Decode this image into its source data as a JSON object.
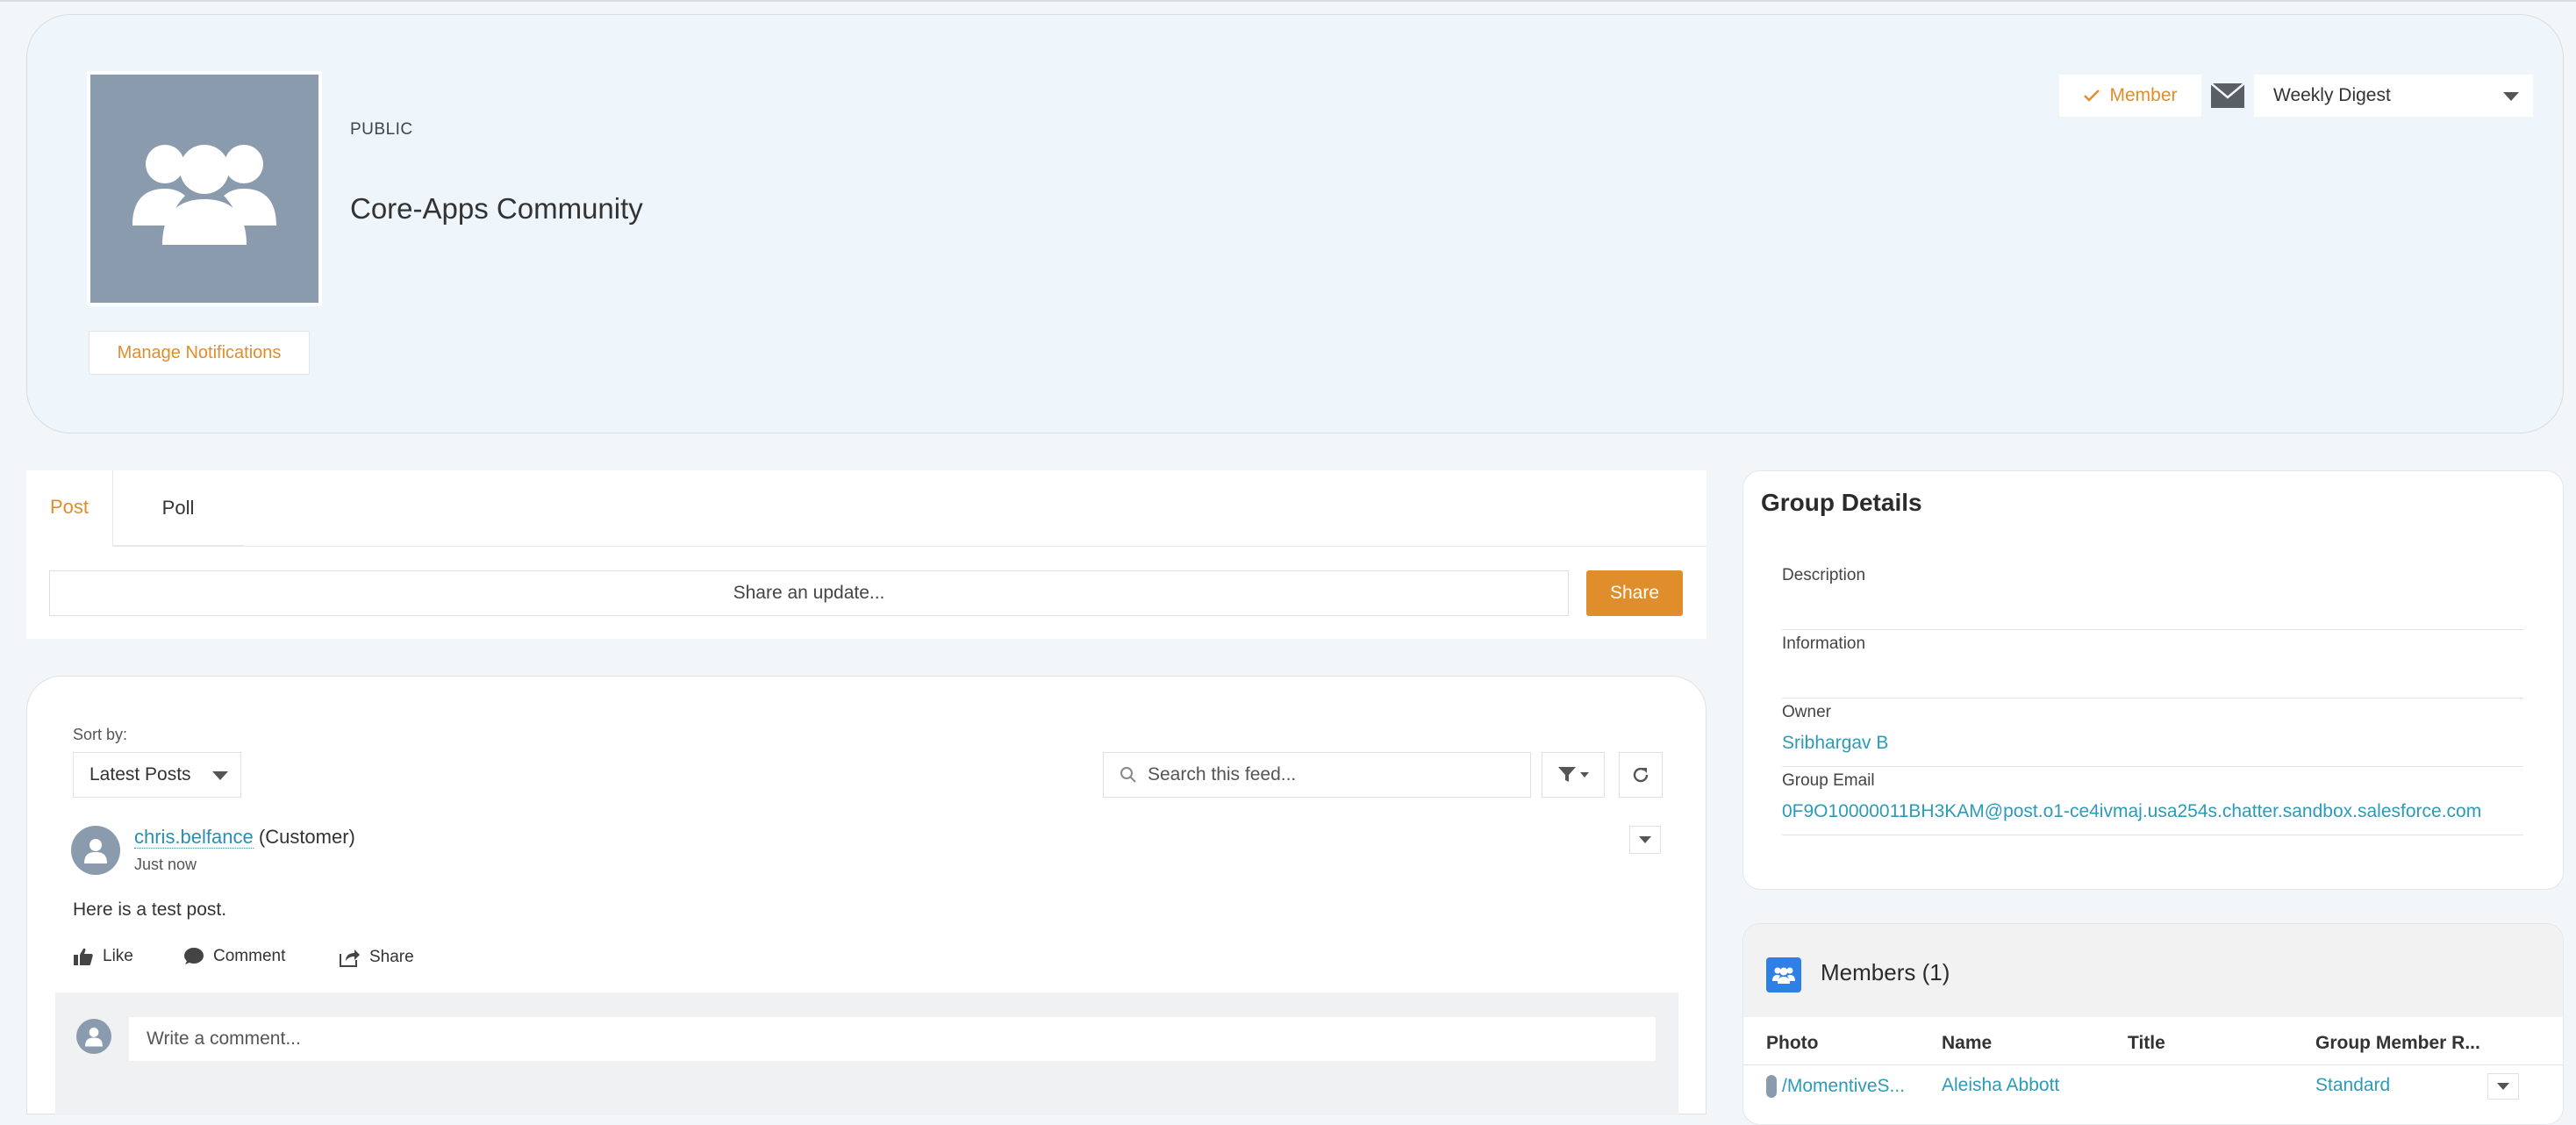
{
  "header": {
    "visibility": "PUBLIC",
    "title": "Core-Apps Community",
    "manage_notifications": "Manage Notifications",
    "member_label": "Member",
    "digest_value": "Weekly Digest"
  },
  "publisher": {
    "tabs": [
      {
        "label": "Post",
        "active": true
      },
      {
        "label": "Poll",
        "active": false
      }
    ],
    "placeholder": "Share an update...",
    "share_label": "Share"
  },
  "feed": {
    "sort_label": "Sort by:",
    "sort_value": "Latest Posts",
    "search_placeholder": "Search this feed...",
    "post": {
      "author": "chris.belfance",
      "author_type": "(Customer)",
      "time": "Just now",
      "body": "Here is a test post.",
      "actions": {
        "like": "Like",
        "comment": "Comment",
        "share": "Share"
      },
      "comment_placeholder": "Write a comment..."
    }
  },
  "details": {
    "title": "Group Details",
    "fields": [
      {
        "label": "Description",
        "value": ""
      },
      {
        "label": "Information",
        "value": ""
      },
      {
        "label": "Owner",
        "value": "Sribhargav B"
      },
      {
        "label": "Group Email",
        "value": "0F9O10000011BH3KAM@post.o1-ce4ivmaj.usa254s.chatter.sandbox.salesforce.com"
      }
    ]
  },
  "members": {
    "title": "Members (1)",
    "columns": [
      "Photo",
      "Name",
      "Title",
      "Group Member R..."
    ],
    "rows": [
      {
        "photo": "/MomentiveS...",
        "name": "Aleisha Abbott",
        "title": "",
        "role": "Standard"
      }
    ]
  },
  "colors": {
    "accent": "#e08d2c",
    "link": "#2b9bb9",
    "avatar_bg": "#8a9bae",
    "members_icon": "#2e7fe6"
  }
}
